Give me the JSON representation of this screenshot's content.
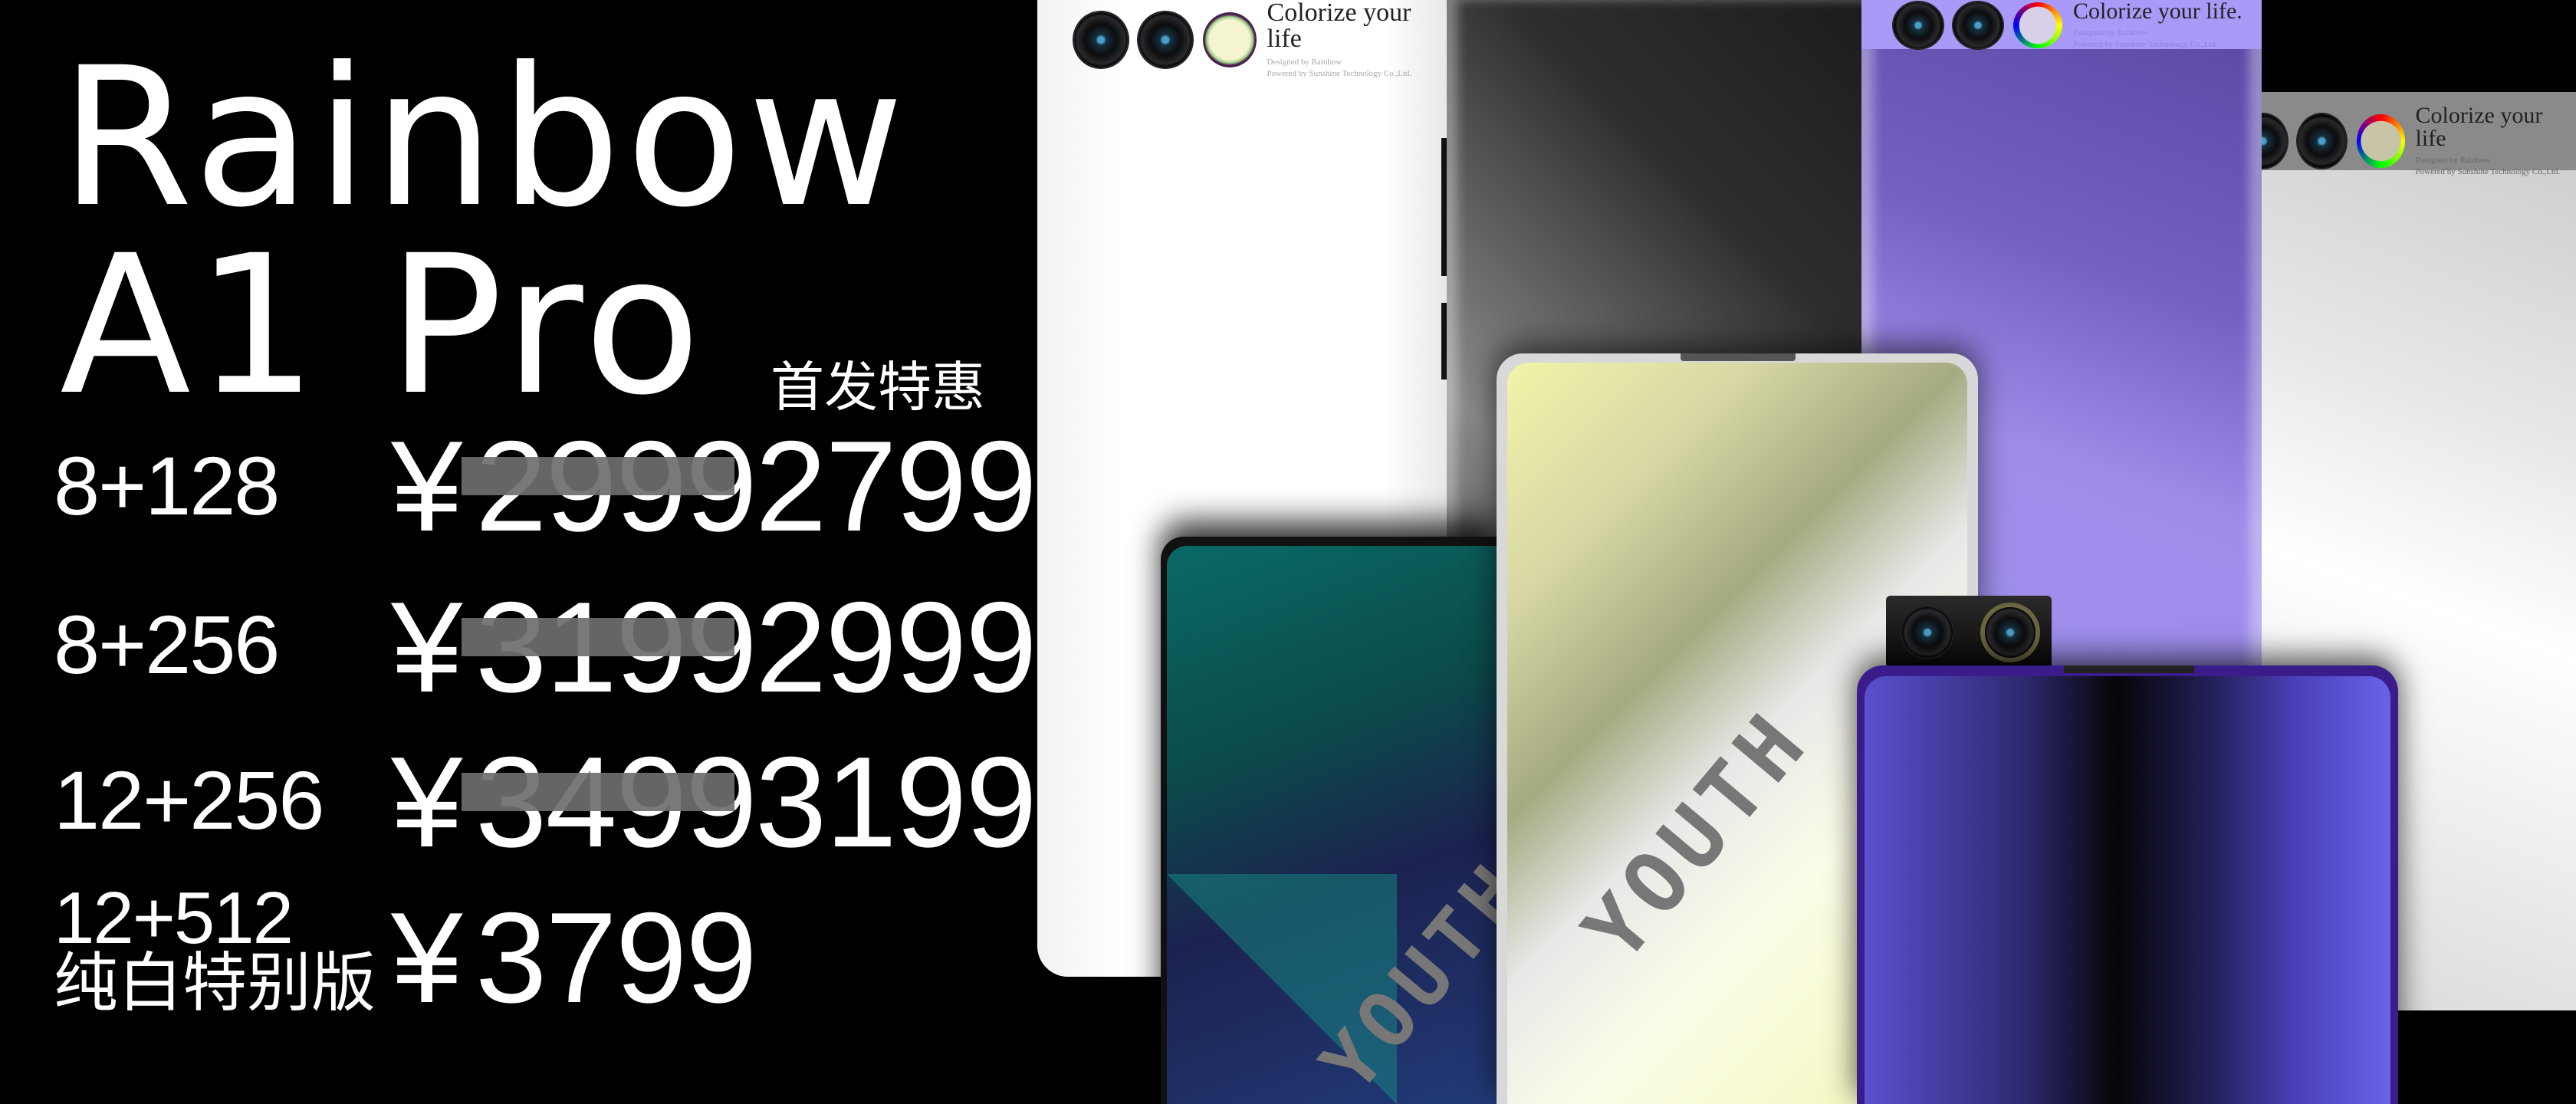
{
  "title": {
    "line1": "Rainbow",
    "line2": "A1 Pro"
  },
  "promo_label": "首发特惠",
  "currency": "¥",
  "prices": [
    {
      "spec": "8+128",
      "original": "2999",
      "promo": "2799"
    },
    {
      "spec": "8+256",
      "original": "3199",
      "promo": "2999"
    },
    {
      "spec": "12+256",
      "original": "3499",
      "promo": "3199"
    },
    {
      "spec": "12+512",
      "edition": "纯白特别版",
      "price": "3799"
    }
  ],
  "phone_branding": {
    "slogan": "Colorize your life",
    "slogan_purple": "Colorize your life.",
    "designed_by": "Designed by Rainbow",
    "powered_by": "Powered by Sunshine Technology Co.,Ltd."
  },
  "youth_mark": "YOUTH",
  "colors": {
    "background": "#000000",
    "text": "#ffffff",
    "strike": "#6e6e6e",
    "purple": "#7b62d0",
    "yellow": "#f4f7b8",
    "teal": "#0d6b6b",
    "indigo": "#5a4fd6"
  }
}
